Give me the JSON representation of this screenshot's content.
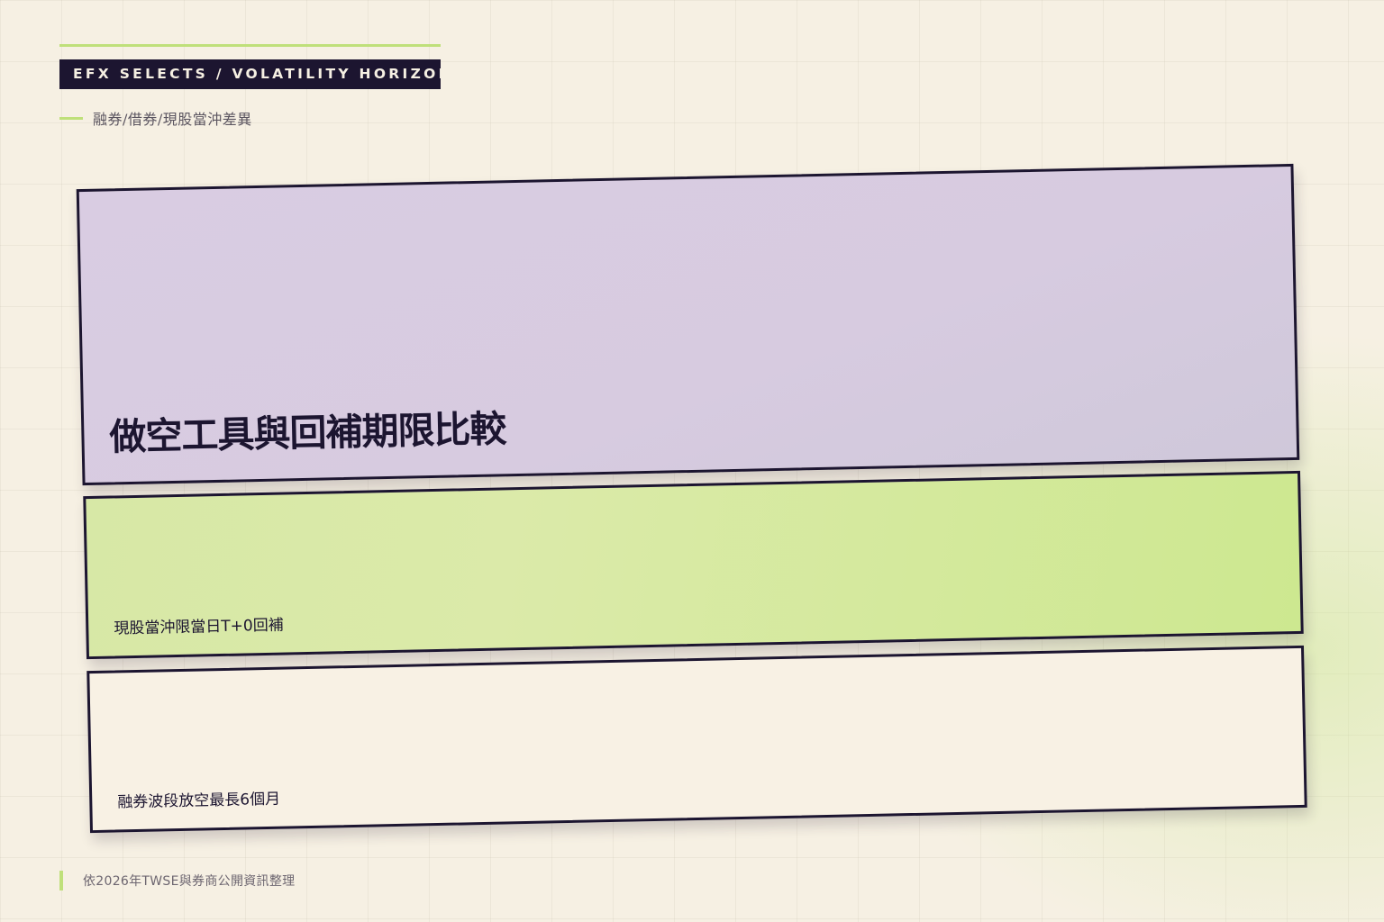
{
  "header": {
    "brand": "EFX SELECTS / VOLATILITY HORIZON",
    "subtitle": "融券/借券/現股當沖差異"
  },
  "panels": {
    "title": "做空工具與回補期限比較",
    "day_trade_note": "現股當沖限當日T+0回補",
    "margin_short_note": "融券波段放空最長6個月"
  },
  "footer": {
    "source": "依2026年TWSE與券商公開資訊整理"
  },
  "colors": {
    "ink": "#1c1530",
    "accent_green": "#bfe07a",
    "panel_purple": "#d9cce2",
    "panel_green": "#d7e8a6",
    "panel_cream": "#f8f1e4",
    "background": "#f6f0e3"
  }
}
